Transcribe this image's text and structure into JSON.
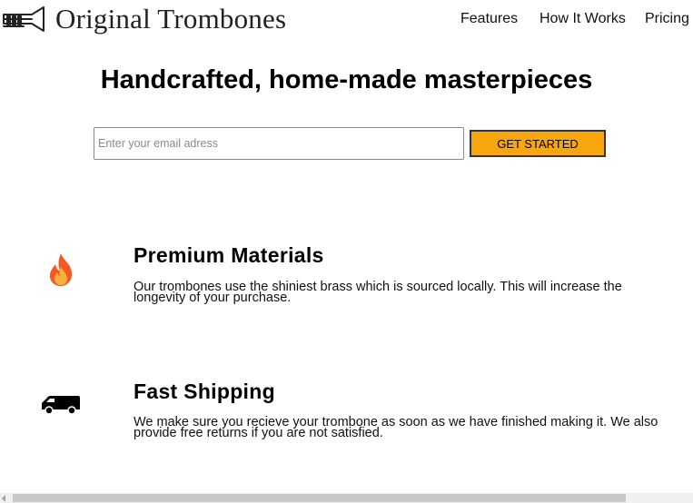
{
  "header": {
    "logo_text": "Original Trombones",
    "logo_icon": "trombone-icon",
    "nav": [
      {
        "label": "Features"
      },
      {
        "label": "How It Works"
      },
      {
        "label": "Pricing"
      }
    ]
  },
  "hero": {
    "title": "Handcrafted, home-made masterpieces",
    "email_placeholder": "Enter your email adress",
    "cta_label": "GET STARTED"
  },
  "features": [
    {
      "icon": "fire-icon",
      "title": "Premium Materials",
      "text": "Our trombones use the shiniest brass which is sourced locally. This will increase the longevity of your purchase."
    },
    {
      "icon": "truck-icon",
      "title": "Fast Shipping",
      "text": "We make sure you recieve your trombone as soon as we have finished making it. We also provide free returns if you are not satisfied."
    }
  ],
  "colors": {
    "cta_background": "#f8a60d",
    "cta_border": "#333333",
    "flame_outer": "#f15a22",
    "flame_inner": "#fbb03b"
  }
}
